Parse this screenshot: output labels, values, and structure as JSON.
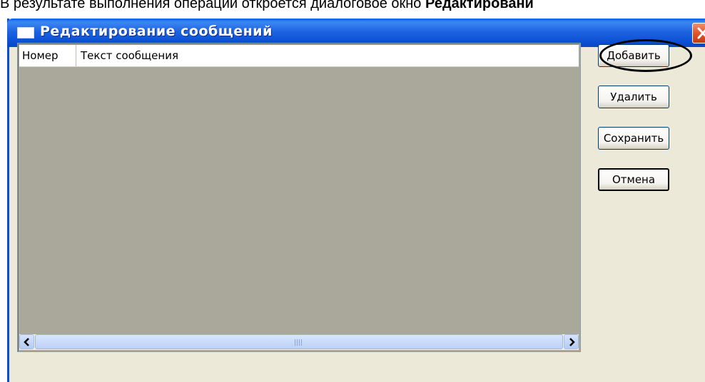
{
  "caption": {
    "prefix": "В результате выполнения операции откроется диалоговое окно ",
    "bold": "Редактировани"
  },
  "dialog": {
    "title": "Редактирование сообщений"
  },
  "table": {
    "columns": [
      "Номер",
      "Текст сообщения"
    ],
    "rows": []
  },
  "scrollbar": {
    "left_icon": "chevron-left-icon",
    "right_icon": "chevron-right-icon"
  },
  "buttons": {
    "add": "Добавить",
    "delete": "Удалить",
    "save": "Сохранить",
    "cancel": "Отмена"
  },
  "colors": {
    "titlebar": "#0a4ed2",
    "list_background": "#aaa89b",
    "close": "#e0552a",
    "highlight": "#000000"
  }
}
